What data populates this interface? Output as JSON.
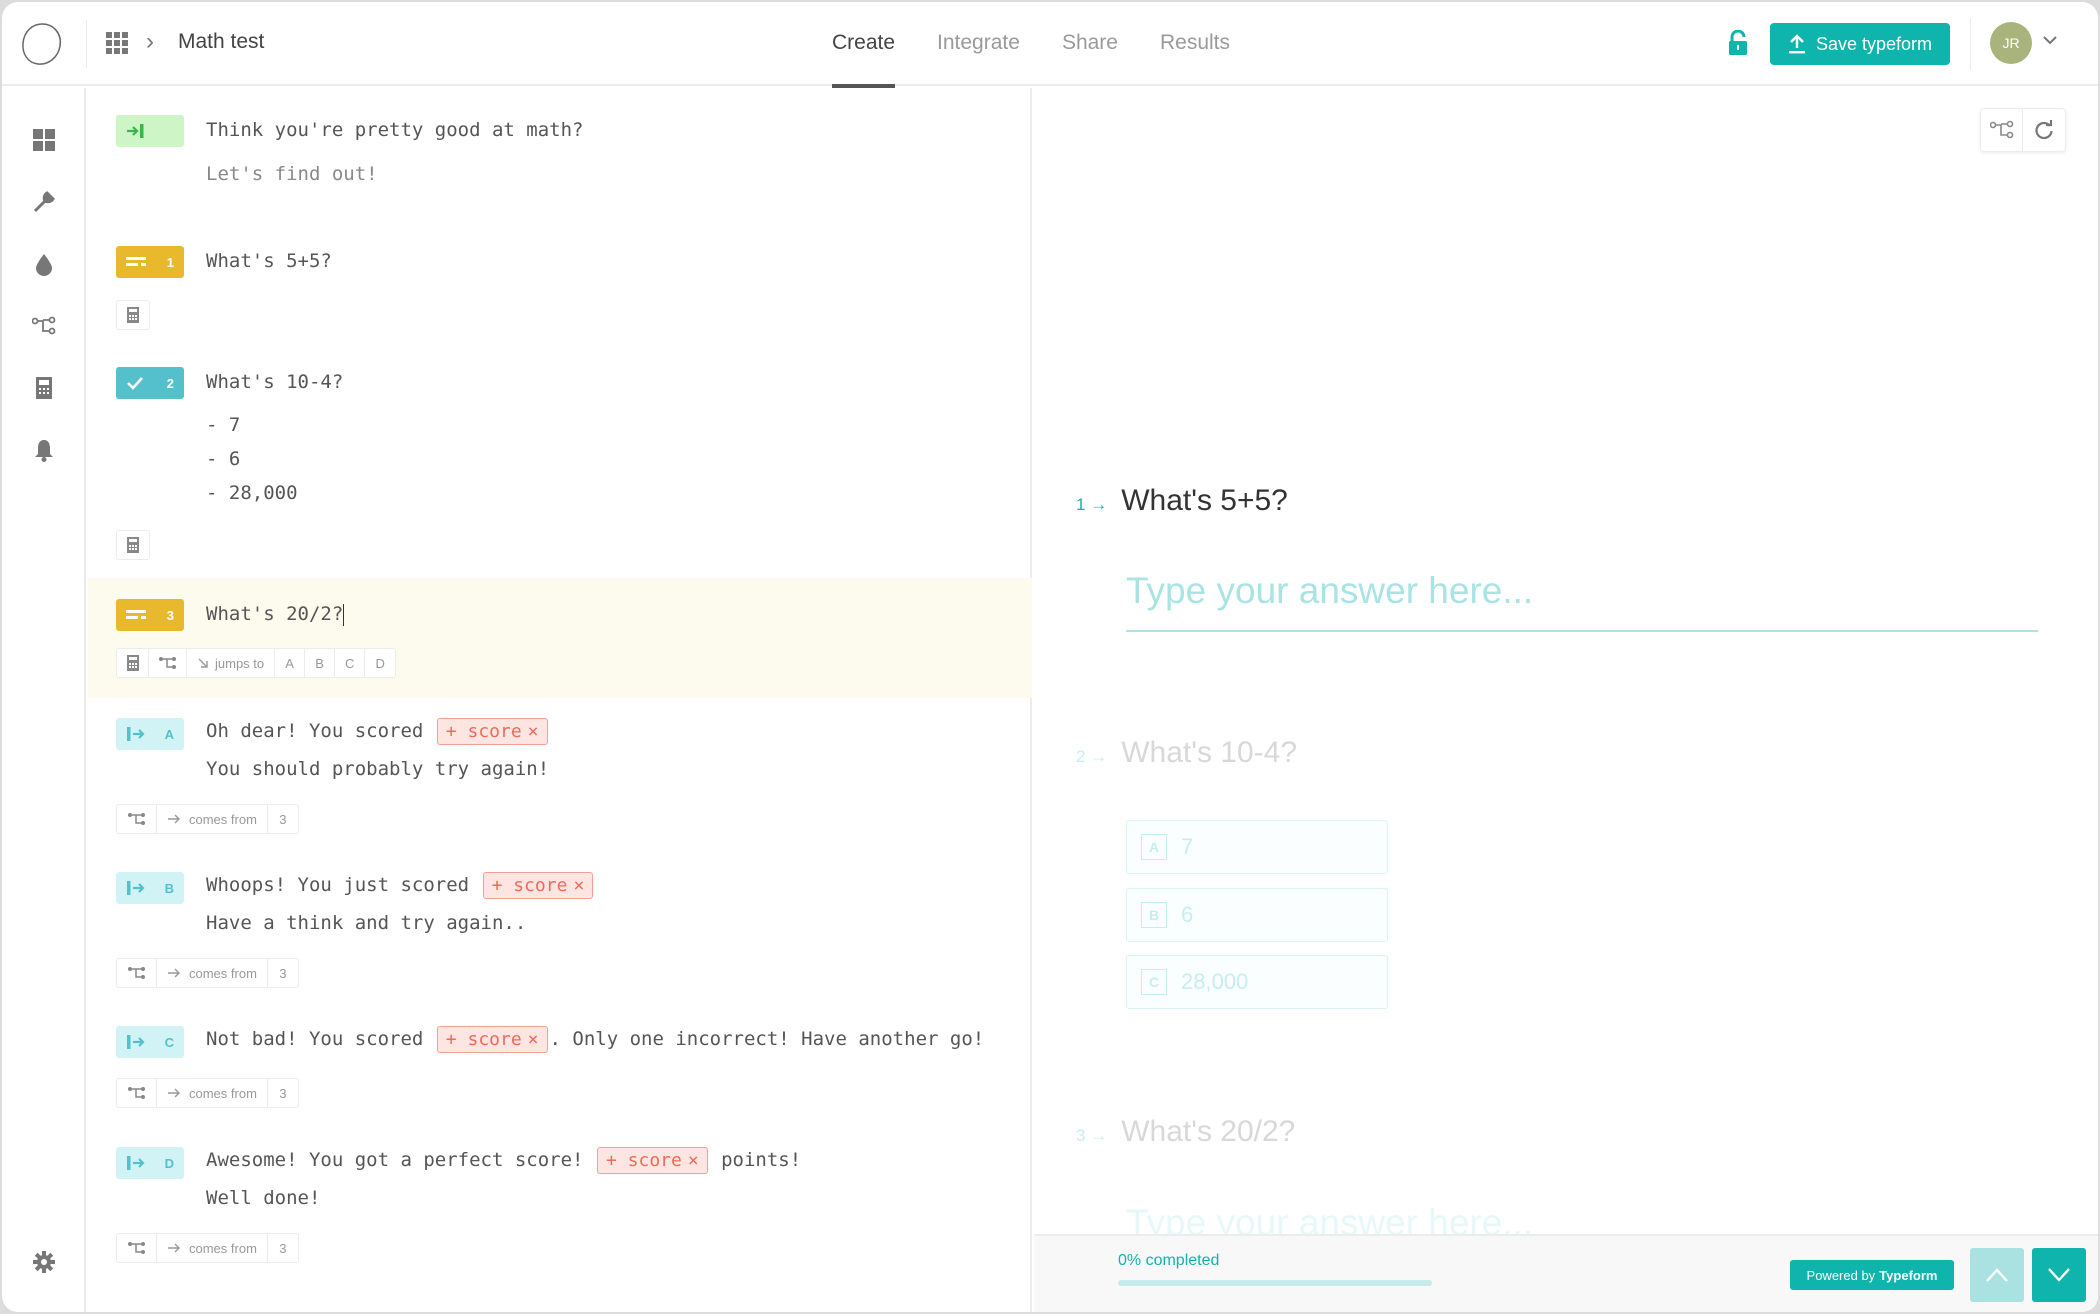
{
  "header": {
    "breadcrumb_separator": "›",
    "form_title": "Math test",
    "tabs": [
      {
        "label": "Create",
        "active": true
      },
      {
        "label": "Integrate",
        "active": false
      },
      {
        "label": "Share",
        "active": false
      },
      {
        "label": "Results",
        "active": false
      }
    ],
    "save_label": "Save typeform",
    "avatar_initials": "JR"
  },
  "rail": {
    "icons": [
      "dashboard-icon",
      "wrench-icon",
      "drop-icon",
      "logic-branch-icon",
      "calculator-icon",
      "bell-icon",
      "gear-icon"
    ]
  },
  "editor": {
    "welcome": {
      "title": "Think you're pretty good at math?",
      "subtitle": "Let's find out!"
    },
    "questions": [
      {
        "number": "1",
        "type": "short-text",
        "title": "What's 5+5?"
      },
      {
        "number": "2",
        "type": "multiple-choice",
        "title": "What's 10-4?",
        "choices": [
          "- 7",
          "- 6",
          "- 28,000"
        ]
      },
      {
        "number": "3",
        "type": "short-text",
        "title": "What's 20/2?",
        "jumps_label": "jumps to",
        "jump_targets": [
          "A",
          "B",
          "C",
          "D"
        ]
      }
    ],
    "endings": [
      {
        "letter": "A",
        "before": "Oh dear! You scored",
        "after": "",
        "line2": "You should probably try again!",
        "comes_from_label": "comes from",
        "comes_from": "3"
      },
      {
        "letter": "B",
        "before": "Whoops! You just scored",
        "after": "",
        "line2": "Have a think and try again..",
        "comes_from_label": "comes from",
        "comes_from": "3"
      },
      {
        "letter": "C",
        "before": "Not bad! You scored",
        "after": ". Only one incorrect! Have another go!",
        "line2": "",
        "comes_from_label": "comes from",
        "comes_from": "3"
      },
      {
        "letter": "D",
        "before": "Awesome! You got a perfect score!",
        "after": " points!",
        "line2": "Well done!",
        "comes_from_label": "comes from",
        "comes_from": "3"
      }
    ],
    "score_chip": {
      "plus": "+",
      "label": "score",
      "remove": "×"
    }
  },
  "preview": {
    "q1": {
      "number": "1",
      "arrow": "→",
      "title": "What's 5+5?",
      "placeholder": "Type your answer here..."
    },
    "q2": {
      "number": "2",
      "arrow": "→",
      "title": "What's 10-4?",
      "choices": [
        {
          "key": "A",
          "label": "7"
        },
        {
          "key": "B",
          "label": "6"
        },
        {
          "key": "C",
          "label": "28,000"
        }
      ]
    },
    "q3": {
      "number": "3",
      "arrow": "→",
      "title": "What's 20/2?",
      "placeholder": "Type your answer here..."
    },
    "progress": {
      "label": "0% completed",
      "percent": 0
    },
    "powered_prefix": "Powered by",
    "powered_brand": "Typeform"
  },
  "colors": {
    "accent": "#0fb4ad",
    "text_question": "#e8b92d",
    "choice_question": "#54c0cc",
    "welcome": "#cdf5c6",
    "score_chip": "#f0695a"
  }
}
